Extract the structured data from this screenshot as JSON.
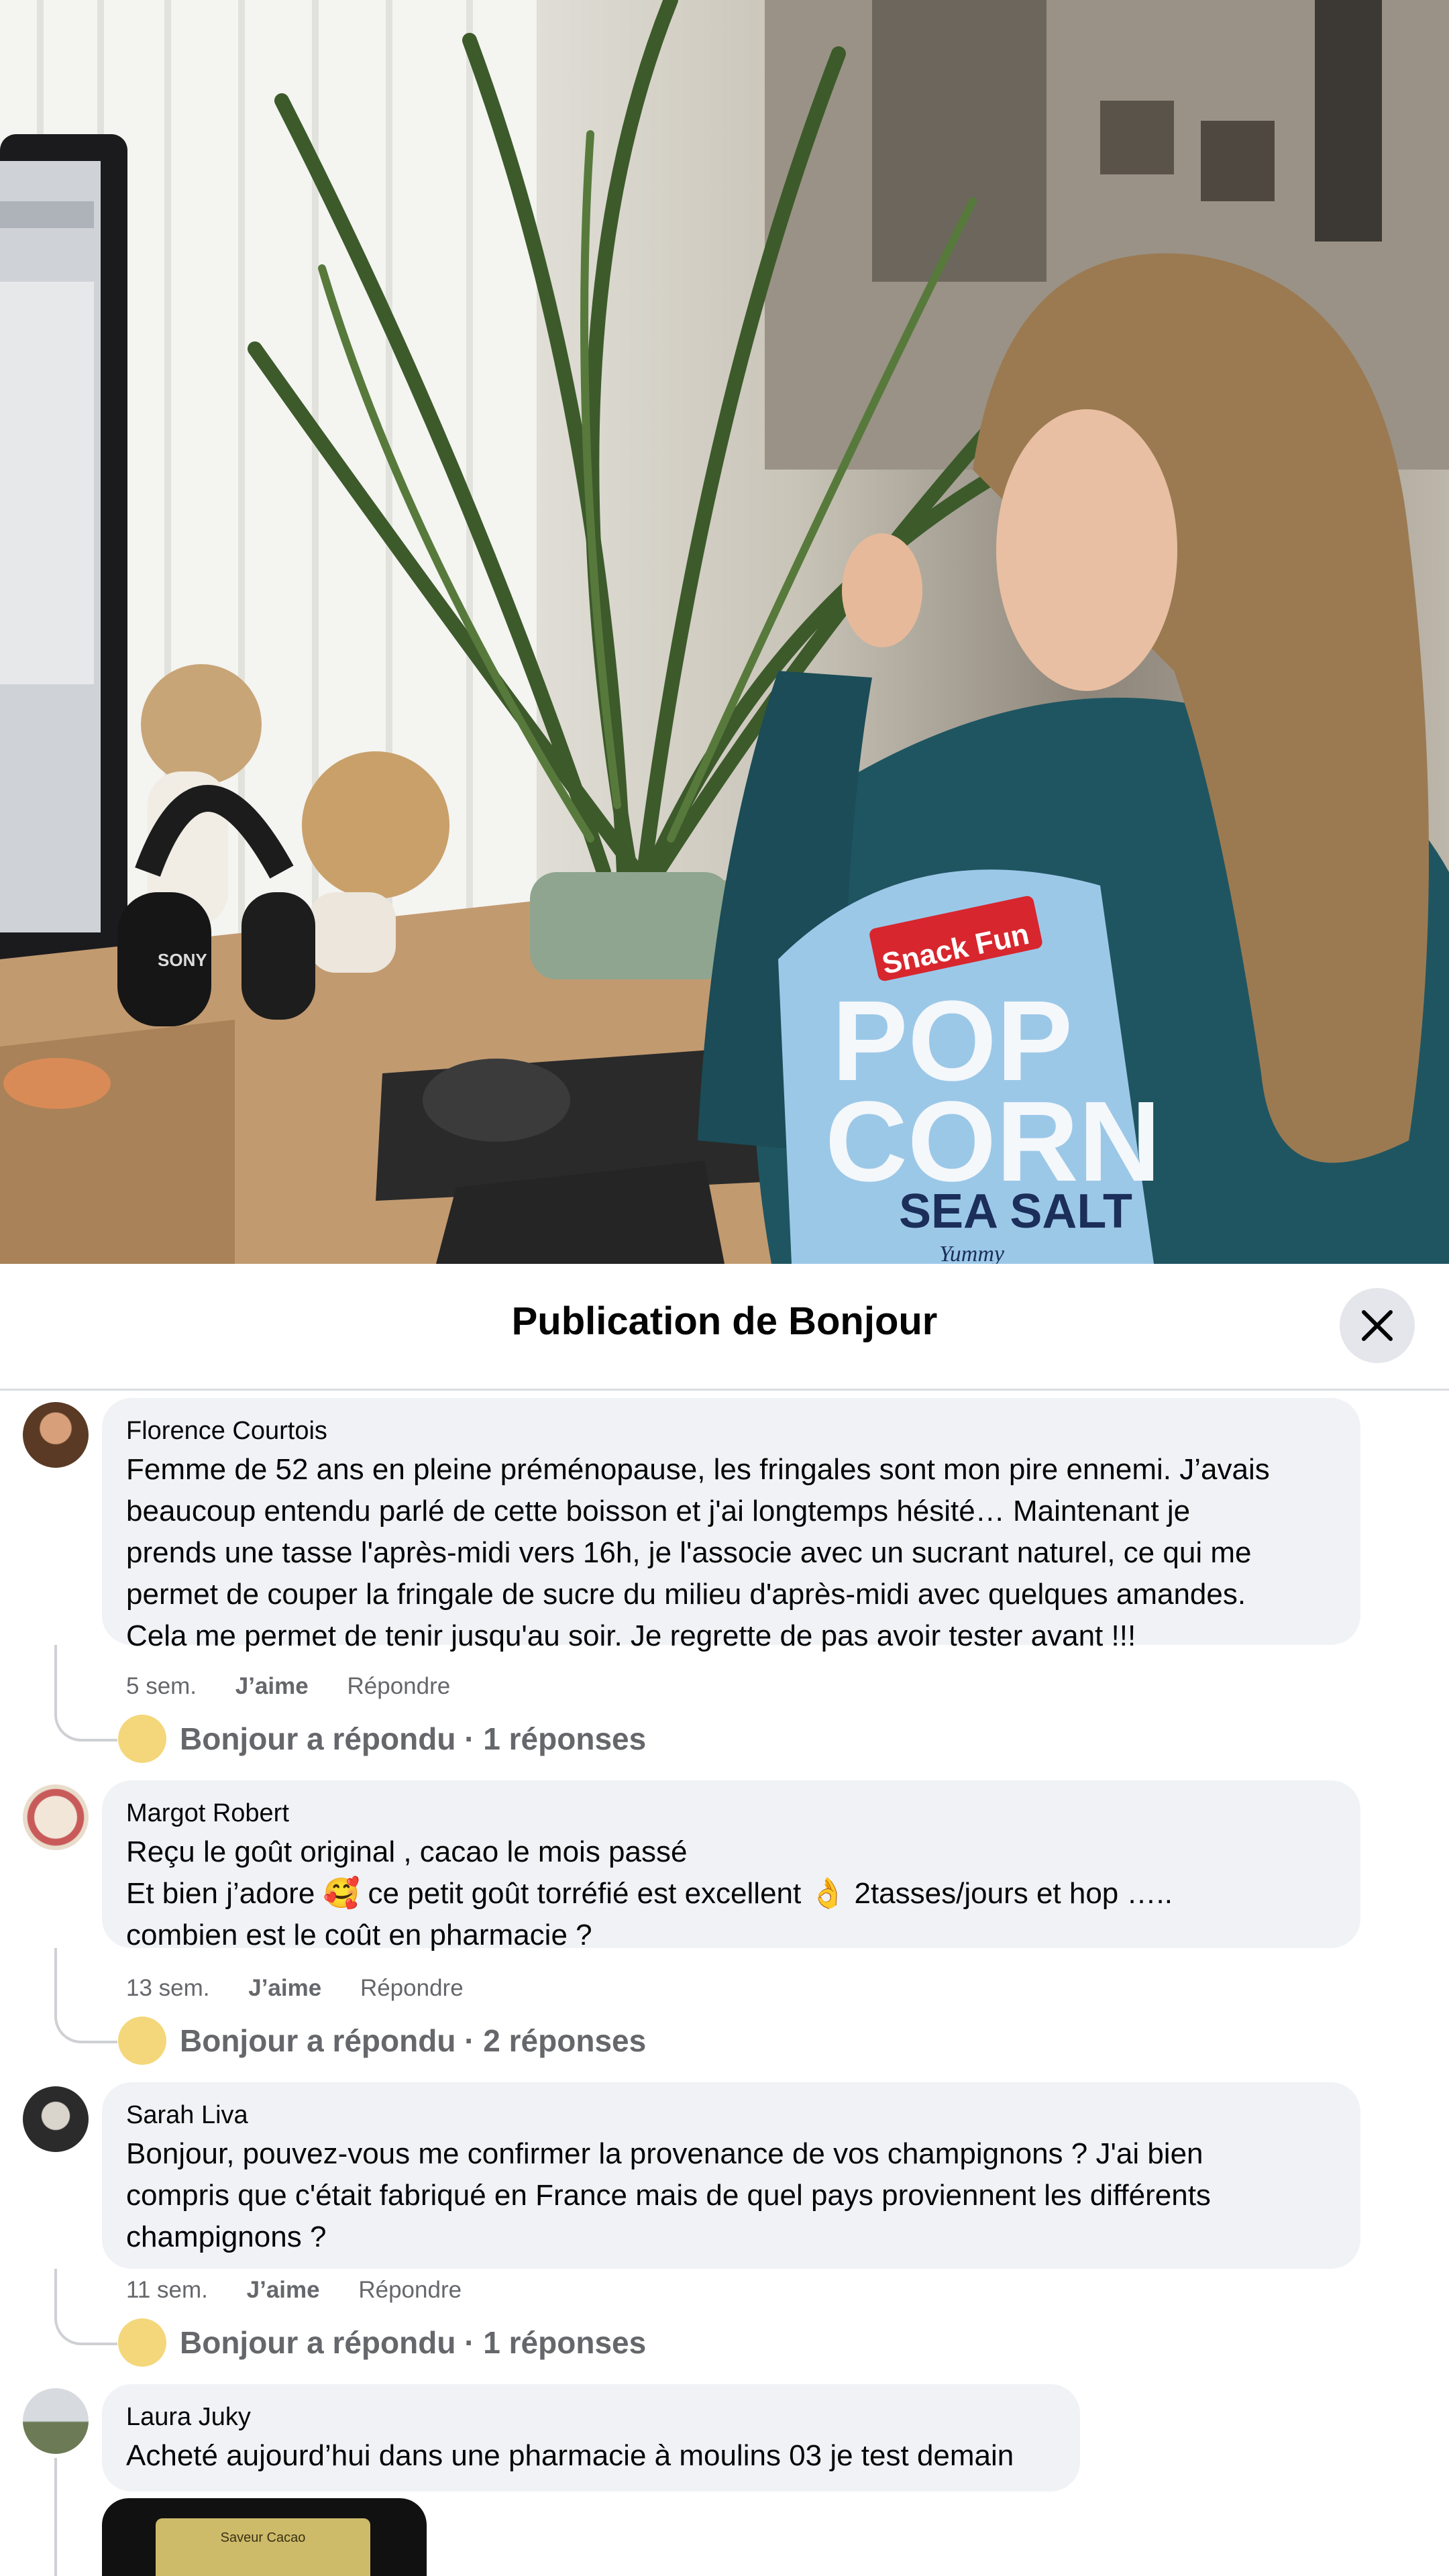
{
  "header": {
    "title": "Publication de Bonjour"
  },
  "photo": {
    "bag_brand": "Snack Fun",
    "bag_text_1": "POP",
    "bag_text_2": "CORN",
    "bag_flavor": "SEA SALT",
    "bag_tagline": "Yummy",
    "headphones_brand": "SONY"
  },
  "comments": [
    {
      "author": "Florence Courtois",
      "lines": [
        "Femme de 52 ans en pleine préménopause, les fringales sont mon pire ennemi. J’avais",
        "beaucoup entendu parlé de cette boisson et j'ai longtemps hésité… Maintenant je",
        "prends une tasse l'après-midi vers 16h, je l'associe avec un sucrant naturel, ce qui me",
        "permet de couper la fringale de sucre du milieu d'après-midi avec quelques amandes.",
        "Cela me permet de tenir jusqu'au soir. Je regrette de pas avoir tester avant !!!"
      ],
      "time": "5 sem.",
      "like": "J’aime",
      "reply": "Répondre",
      "replies": "Bonjour a répondu · 1 réponses"
    },
    {
      "author": "Margot Robert",
      "line1": "Reçu le goût original , cacao le mois passé",
      "line2a": "Et bien j’adore ",
      "emoji1": "🥰",
      "line2b": " ce petit goût torréfié est excellent ",
      "emoji2": "👌",
      "line2c": " 2tasses/jours et hop …..",
      "line3": "combien est le coût en pharmacie ?",
      "time": "13 sem.",
      "like": "J’aime",
      "reply": "Répondre",
      "replies": "Bonjour a répondu · 2 réponses"
    },
    {
      "author": "Sarah Liva",
      "lines": [
        "Bonjour, pouvez-vous me confirmer la provenance de vos champignons ? J'ai bien",
        "compris que c'était fabriqué en France mais de quel pays proviennent les différents",
        "champignons ?"
      ],
      "time": "11 sem.",
      "like": "J’aime",
      "reply": "Répondre",
      "replies": "Bonjour a répondu · 1 réponses"
    },
    {
      "author": "Laura Juky",
      "lines": [
        "Acheté aujourd’hui dans une pharmacie à moulins 03 je test demain"
      ],
      "attachment_text": "Saveur Cacao"
    }
  ]
}
